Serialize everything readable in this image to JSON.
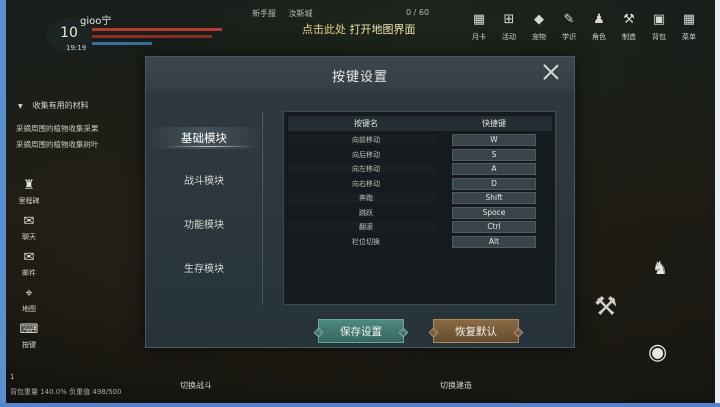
{
  "hud": {
    "player_name": "gioo宁",
    "level": "10",
    "level_time": "19:19",
    "location_a": "新手服",
    "location_b": "汝斯城",
    "coords": "0 / 60",
    "map_tip_prefix": "点击此处",
    "map_tip": "打开地图界面",
    "top_menu": [
      {
        "label": "月卡",
        "icon": "calendar-icon",
        "glyph": "▦"
      },
      {
        "label": "活动",
        "icon": "gift-icon",
        "glyph": "⊞"
      },
      {
        "label": "宠物",
        "icon": "pet-icon",
        "glyph": "◆"
      },
      {
        "label": "学识",
        "icon": "knowledge-icon",
        "glyph": "✎"
      },
      {
        "label": "角色",
        "icon": "character-icon",
        "glyph": "♟"
      },
      {
        "label": "制造",
        "icon": "craft-icon",
        "glyph": "⚒"
      },
      {
        "label": "背包",
        "icon": "bag-icon",
        "glyph": "▣"
      },
      {
        "label": "菜单",
        "icon": "menu-icon",
        "glyph": "▦"
      }
    ],
    "quest_title": "收集有用的材料",
    "quest_lines": [
      "采摘周围的植物收集采果",
      "采摘周围的植物收集树叶"
    ],
    "left_menu": [
      {
        "label": "里程碑",
        "icon": "milestone-icon",
        "glyph": "♜"
      },
      {
        "label": "聊天",
        "icon": "chat-icon",
        "glyph": "✉"
      },
      {
        "label": "邮件",
        "icon": "mail-icon",
        "glyph": "✉"
      },
      {
        "label": "地图",
        "icon": "map-pin-icon",
        "glyph": "⌖"
      },
      {
        "label": "按键",
        "icon": "keyboard-icon",
        "glyph": "⌨"
      }
    ],
    "bottom_level": "1",
    "bottom_info": "背包重量 140.0%   负重值 498/500",
    "bottom_action_left": "切换战斗",
    "bottom_action_right": "切换建造"
  },
  "dialog": {
    "title": "按键设置",
    "tabs": [
      {
        "label": "基础模块",
        "active": true
      },
      {
        "label": "战斗模块",
        "active": false
      },
      {
        "label": "功能模块",
        "active": false
      },
      {
        "label": "生存模块",
        "active": false
      }
    ],
    "table": {
      "col_action": "按键名",
      "col_key": "快捷键",
      "rows": [
        {
          "action": "向前移动",
          "key": "W"
        },
        {
          "action": "向后移动",
          "key": "S"
        },
        {
          "action": "向左移动",
          "key": "A"
        },
        {
          "action": "向右移动",
          "key": "D"
        },
        {
          "action": "奔跑",
          "key": "Shift"
        },
        {
          "action": "跳跃",
          "key": "Spoce"
        },
        {
          "action": "翻滚",
          "key": "Ctrl"
        },
        {
          "action": "栏位切换",
          "key": "Alt"
        }
      ]
    },
    "save_label": "保存设置",
    "reset_label": "恢复默认"
  },
  "colors": {
    "accent_save": "#4d8a7f",
    "accent_reset": "#8a6a44",
    "frame_blue": "#5a8fd1"
  }
}
